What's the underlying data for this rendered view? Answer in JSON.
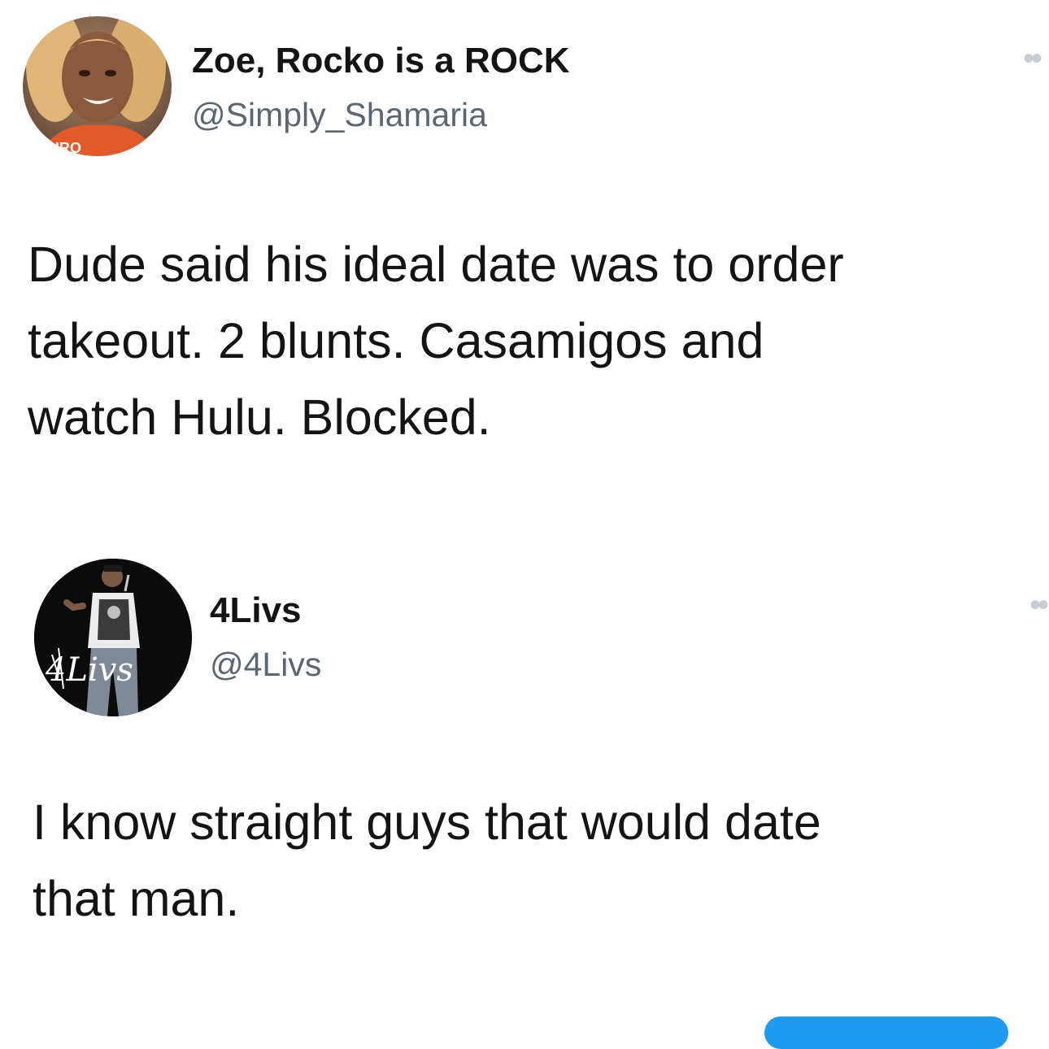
{
  "tweets": [
    {
      "display_name": "Zoe, Rocko is a ROCK",
      "handle": "@Simply_Shamaria",
      "more_icon": "ellipsis-icon",
      "text": "Dude said his ideal date was to order\ntakeout. 2 blunts. Casamigos and\nwatch Hulu. Blocked."
    },
    {
      "display_name": "4Livs",
      "handle": "@4Livs",
      "more_icon": "ellipsis-icon",
      "text": "I know straight guys that would date\nthat man.",
      "avatar_signature": "4Livs"
    }
  ],
  "colors": {
    "text": "#141414",
    "handle": "#5b6670",
    "accent": "#1d9bf0"
  }
}
